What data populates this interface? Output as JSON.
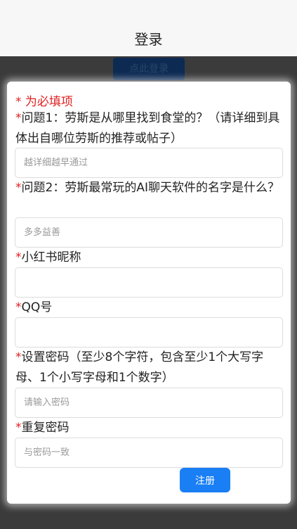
{
  "header": {
    "title": "登录"
  },
  "background_button": {
    "label": "点此登录"
  },
  "form": {
    "required_note": "* 为必填项",
    "fields": [
      {
        "label": "问题1：劳斯是从哪里找到食堂的？（请详细到具体出自哪位劳斯的推荐或帖子）",
        "placeholder": "越详细越早通过",
        "value": ""
      },
      {
        "label": "问题2：劳斯最常玩的AI聊天软件的名字是什么？",
        "placeholder": "多多益善",
        "value": ""
      },
      {
        "label": "小红书昵称",
        "placeholder": "",
        "value": ""
      },
      {
        "label": "QQ号",
        "placeholder": "",
        "value": ""
      },
      {
        "label": "设置密码（至少8个字符，包含至少1个大写字母、1个小写字母和1个数字）",
        "placeholder": "请输入密码",
        "value": ""
      },
      {
        "label": "重复密码",
        "placeholder": "与密码一致",
        "value": ""
      }
    ],
    "required_marker": "*",
    "submit_label": "注册"
  },
  "colors": {
    "accent": "#1a7ff5",
    "required": "#e02020",
    "overlay": "#3b3b3b"
  }
}
